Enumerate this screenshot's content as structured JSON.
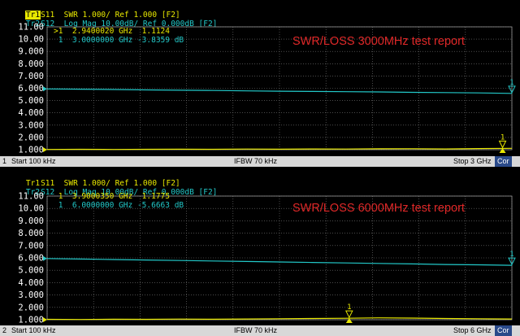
{
  "panels": [
    {
      "trace1_id": "Tr1",
      "trace1_text": "S11  SWR 1.000/ Ref 1.000 [F2]",
      "trace2_id": "Tr2",
      "trace2_text": "S12  Log Mag 10.00dB/ Ref 0.000dB [F2]",
      "y_ticks": [
        "11.00",
        "10.00",
        "9.000",
        "8.000",
        "7.000",
        "6.000",
        "5.000",
        "4.000",
        "3.000",
        "2.000",
        "1.000"
      ],
      "marker1_readout": ">1  2.9400020 GHz  1.1124",
      "marker2_readout": " 1  3.0000000 GHz -3.8359 dB",
      "report_title": "SWR/LOSS 3000MHz test report",
      "swr_marker_label": "1",
      "loss_marker_label": "1",
      "status": {
        "channel": "1",
        "start": "Start 100 kHz",
        "ifbw": "IFBW 70 kHz",
        "stop": "Stop 3 GHz",
        "cor": "Cor"
      },
      "chart_data": {
        "type": "line",
        "x_range_ghz": [
          0.0001,
          3
        ],
        "ylim": [
          1,
          11
        ],
        "series": [
          {
            "values": [
              1.02,
              1.03,
              1.02,
              1.03,
              1.04,
              1.03,
              1.05,
              1.04,
              1.06,
              1.05,
              1.07,
              1.08,
              1.06,
              1.09,
              1.11
            ]
          },
          {
            "values": [
              5.95,
              5.93,
              5.9,
              5.87,
              5.84,
              5.82,
              5.79,
              5.76,
              5.74,
              5.72,
              5.7,
              5.67,
              5.65,
              5.62,
              5.58
            ]
          }
        ],
        "swr_marker_x_ghz": 2.94,
        "loss_marker_x_ghz": 3.0
      }
    },
    {
      "trace1_id": "Tr1",
      "trace1_text": "S11  SWR 1.000/ Ref 1.000 [F2]",
      "trace2_id": "Tr2",
      "trace2_text": "S12  Log Mag 10.00dB/ Ref 0.000dB [F2]",
      "y_ticks": [
        "11.00",
        "10.00",
        "9.000",
        "8.000",
        "7.000",
        "6.000",
        "5.000",
        "4.000",
        "3.000",
        "2.000",
        "1.000"
      ],
      "marker1_readout": " 1  3.9000350 GHz  1.1775",
      "marker2_readout": " 1  6.0000000 GHz -5.6663 dB",
      "report_title": "SWR/LOSS 6000MHz test report",
      "swr_marker_label": "1",
      "loss_marker_label": "1",
      "status": {
        "channel": "2",
        "start": "Start 100 kHz",
        "ifbw": "IFBW 70 kHz",
        "stop": "Stop 6 GHz",
        "cor": "Cor"
      },
      "chart_data": {
        "type": "line",
        "x_range_ghz": [
          0.0001,
          6
        ],
        "ylim": [
          1,
          11
        ],
        "series": [
          {
            "values": [
              1.03,
              1.02,
              1.04,
              1.03,
              1.05,
              1.04,
              1.06,
              1.08,
              1.1,
              1.12,
              1.15,
              1.13,
              1.1,
              1.08,
              1.06
            ]
          },
          {
            "values": [
              5.95,
              5.91,
              5.87,
              5.83,
              5.79,
              5.75,
              5.71,
              5.67,
              5.63,
              5.59,
              5.55,
              5.51,
              5.47,
              5.44,
              5.4
            ]
          }
        ],
        "swr_marker_x_ghz": 3.900035,
        "loss_marker_x_ghz": 6.0
      }
    }
  ],
  "colors": {
    "swr_trace": "#e8e800",
    "loss_trace": "#22c8c8",
    "grid": "#7a7a7a",
    "title": "#e02828"
  }
}
